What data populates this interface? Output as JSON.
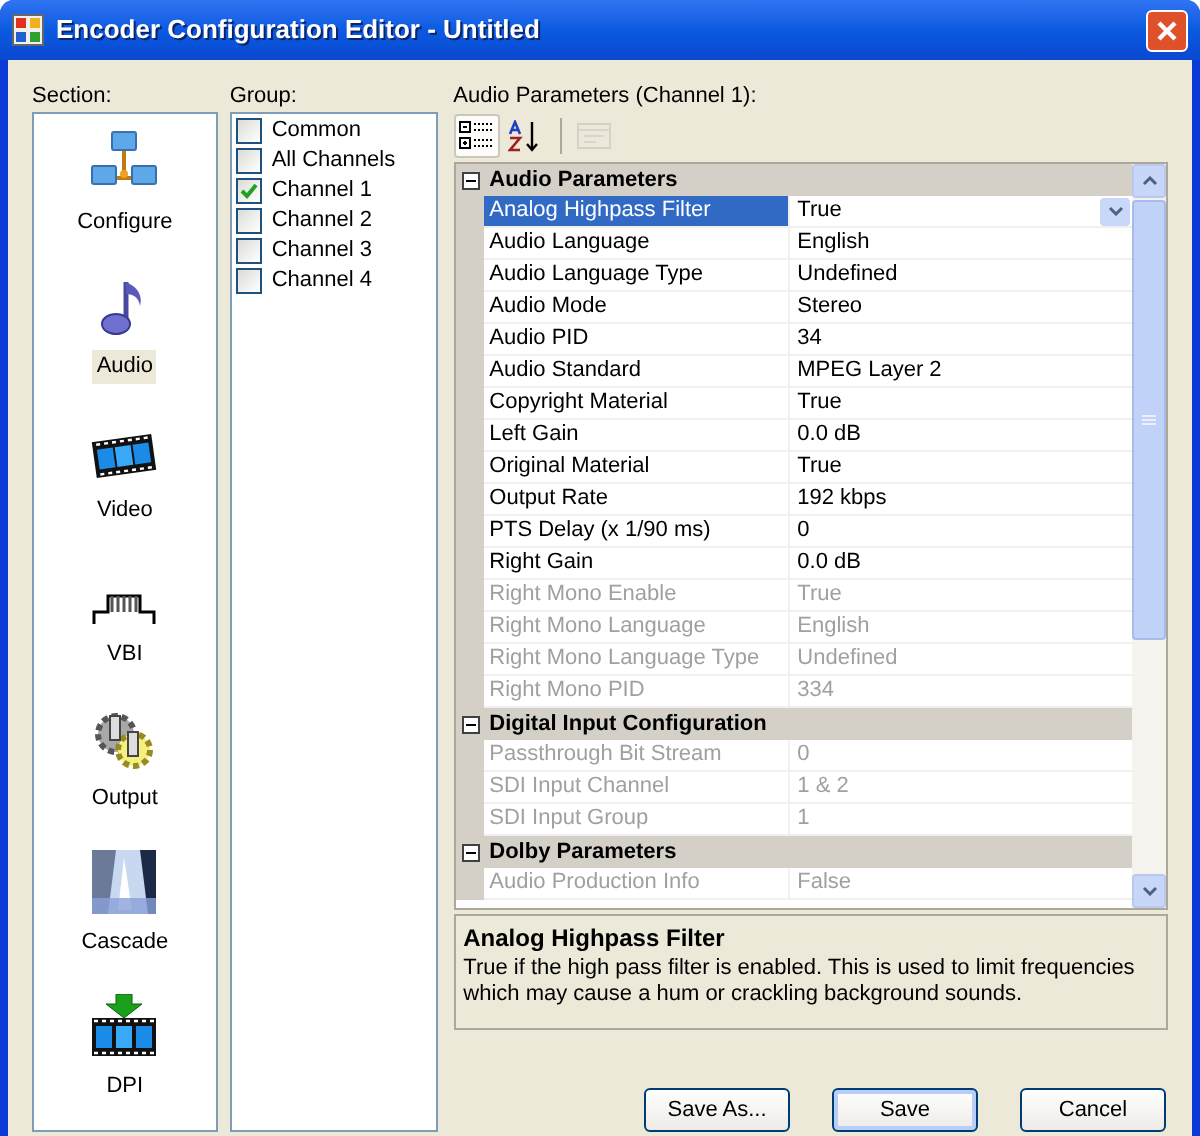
{
  "window": {
    "title": "Encoder Configuration Editor - Untitled"
  },
  "section": {
    "label": "Section:",
    "items": [
      {
        "label": "Configure",
        "kind": "network",
        "selected": false
      },
      {
        "label": "Audio",
        "kind": "note",
        "selected": true
      },
      {
        "label": "Video",
        "kind": "film",
        "selected": false
      },
      {
        "label": "VBI",
        "kind": "pulse",
        "selected": false
      },
      {
        "label": "Output",
        "kind": "gears",
        "selected": false
      },
      {
        "label": "Cascade",
        "kind": "waterfall",
        "selected": false
      },
      {
        "label": "DPI",
        "kind": "filmdown",
        "selected": false
      }
    ]
  },
  "group": {
    "label": "Group:",
    "items": [
      {
        "label": "Common",
        "checked": false
      },
      {
        "label": "All Channels",
        "checked": false
      },
      {
        "label": "Channel 1",
        "checked": true
      },
      {
        "label": "Channel 2",
        "checked": false
      },
      {
        "label": "Channel 3",
        "checked": false
      },
      {
        "label": "Channel 4",
        "checked": false
      }
    ]
  },
  "properties": {
    "label": "Audio Parameters (Channel 1):",
    "toolbar": [
      {
        "kind": "categorized",
        "selected": true,
        "disabled": false
      },
      {
        "kind": "alphabetical",
        "selected": false,
        "disabled": false
      },
      {
        "kind": "pages",
        "selected": false,
        "disabled": true
      }
    ],
    "categories": [
      {
        "title": "Audio Parameters",
        "expanded": true,
        "rows": [
          {
            "name": "Analog Highpass Filter",
            "value": "True",
            "selected": true,
            "disabled": false
          },
          {
            "name": "Audio Language",
            "value": "English",
            "selected": false,
            "disabled": false
          },
          {
            "name": "Audio Language Type",
            "value": "Undefined",
            "selected": false,
            "disabled": false
          },
          {
            "name": "Audio Mode",
            "value": "Stereo",
            "selected": false,
            "disabled": false
          },
          {
            "name": "Audio PID",
            "value": "34",
            "selected": false,
            "disabled": false
          },
          {
            "name": "Audio Standard",
            "value": "MPEG Layer 2",
            "selected": false,
            "disabled": false
          },
          {
            "name": "Copyright Material",
            "value": "True",
            "selected": false,
            "disabled": false
          },
          {
            "name": "Left Gain",
            "value": "0.0 dB",
            "selected": false,
            "disabled": false
          },
          {
            "name": "Original Material",
            "value": "True",
            "selected": false,
            "disabled": false
          },
          {
            "name": "Output Rate",
            "value": "192 kbps",
            "selected": false,
            "disabled": false
          },
          {
            "name": "PTS Delay (x 1/90 ms)",
            "value": "0",
            "selected": false,
            "disabled": false
          },
          {
            "name": "Right Gain",
            "value": "0.0 dB",
            "selected": false,
            "disabled": false
          },
          {
            "name": "Right Mono Enable",
            "value": "True",
            "selected": false,
            "disabled": true
          },
          {
            "name": "Right Mono Language",
            "value": "English",
            "selected": false,
            "disabled": true
          },
          {
            "name": "Right Mono Language Type",
            "value": "Undefined",
            "selected": false,
            "disabled": true
          },
          {
            "name": "Right Mono PID",
            "value": "334",
            "selected": false,
            "disabled": true
          }
        ]
      },
      {
        "title": "Digital Input Configuration",
        "expanded": true,
        "rows": [
          {
            "name": "Passthrough Bit Stream",
            "value": "0",
            "selected": false,
            "disabled": true
          },
          {
            "name": "SDI Input Channel",
            "value": "1 & 2",
            "selected": false,
            "disabled": true
          },
          {
            "name": "SDI Input Group",
            "value": "1",
            "selected": false,
            "disabled": true
          }
        ]
      },
      {
        "title": "Dolby Parameters",
        "expanded": true,
        "rows": [
          {
            "name": "Audio Production Info",
            "value": "False",
            "selected": false,
            "disabled": true
          }
        ]
      }
    ],
    "description": {
      "title": "Analog Highpass Filter",
      "text": "True if the high pass filter is enabled. This is used to limit frequencies which may cause a hum or crackling background sounds."
    }
  },
  "buttons": [
    {
      "label": "Save As...",
      "default": false
    },
    {
      "label": "Save",
      "default": true
    },
    {
      "label": "Cancel",
      "default": false
    }
  ]
}
